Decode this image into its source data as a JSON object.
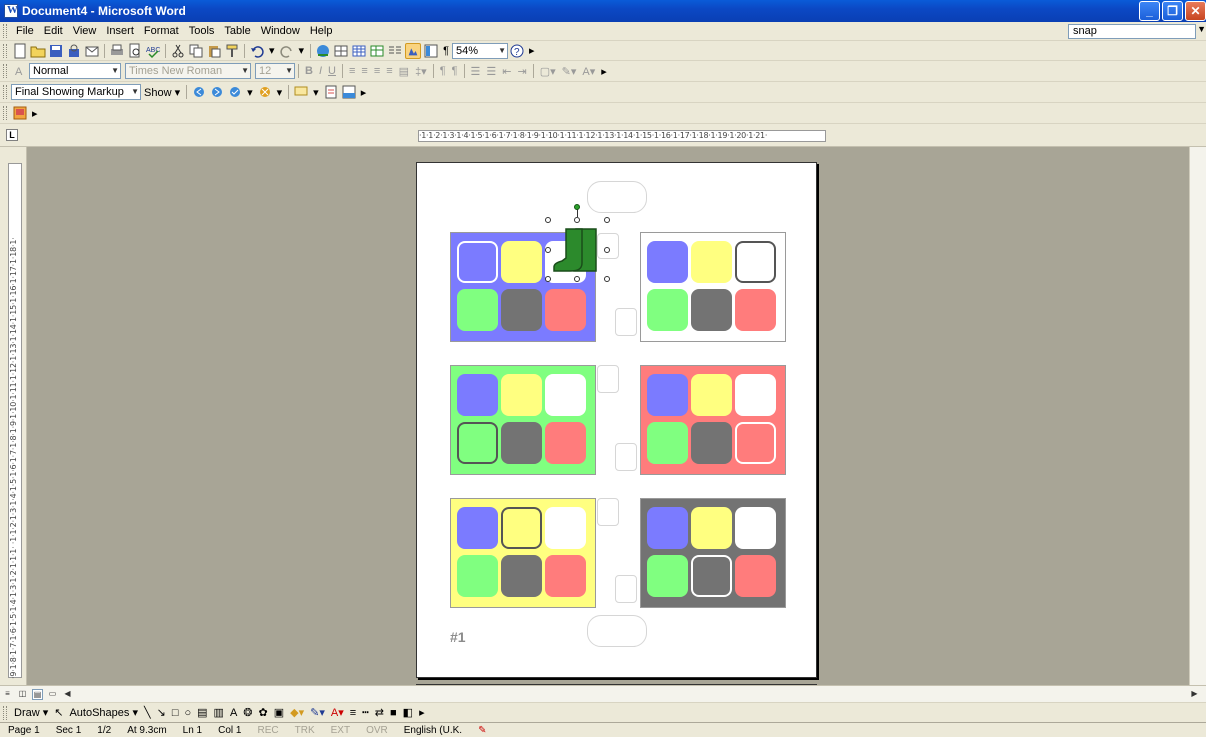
{
  "window": {
    "title": "Document4 - Microsoft Word"
  },
  "menu": {
    "items": [
      "File",
      "Edit",
      "View",
      "Insert",
      "Format",
      "Tools",
      "Table",
      "Window",
      "Help"
    ],
    "help_box": "snap"
  },
  "standard_toolbar": {
    "zoom": "54%"
  },
  "formatting_toolbar": {
    "style": "Normal",
    "font": "Times New Roman",
    "size": "12"
  },
  "reviewing_toolbar": {
    "display": "Final Showing Markup",
    "show_label": "Show"
  },
  "ruler": {
    "tab_selector": "L",
    "horizontal_text": "·1·1·2·1·3·1·4·1·5·1·6·1·7·1·8·1·9·1·10·1·11·1·12·1·13·1·14·1·15·1·16·1·17·1·18·1·19·1·20·1·21·",
    "vertical_text": "·9·1·8·1·7·1·6·1·5·1·4·1·3·1·2·1·1·1· ·1·1·2·1·3·1·4·1·5·1·6·1·7·1·8·1·9·1·10·1·11·1·12·1·13·1·14·1·15·1·16·1·17·1·18·1·"
  },
  "document": {
    "page_label": "#1"
  },
  "colors": {
    "blue": "#7b7bff",
    "yellow": "#ffff80",
    "white": "#ffffff",
    "green": "#80ff80",
    "gray": "#737373",
    "red": "#ff7c7c",
    "boot": "#2c8a2c"
  },
  "draw_toolbar": {
    "draw_label": "Draw",
    "autoshapes_label": "AutoShapes"
  },
  "status": {
    "page": "Page 1",
    "sec": "Sec 1",
    "pages": "1/2",
    "at": "At 9.3cm",
    "ln": "Ln 1",
    "col": "Col 1",
    "rec": "REC",
    "trk": "TRK",
    "ext": "EXT",
    "ovr": "OVR",
    "language": "English (U.K."
  }
}
